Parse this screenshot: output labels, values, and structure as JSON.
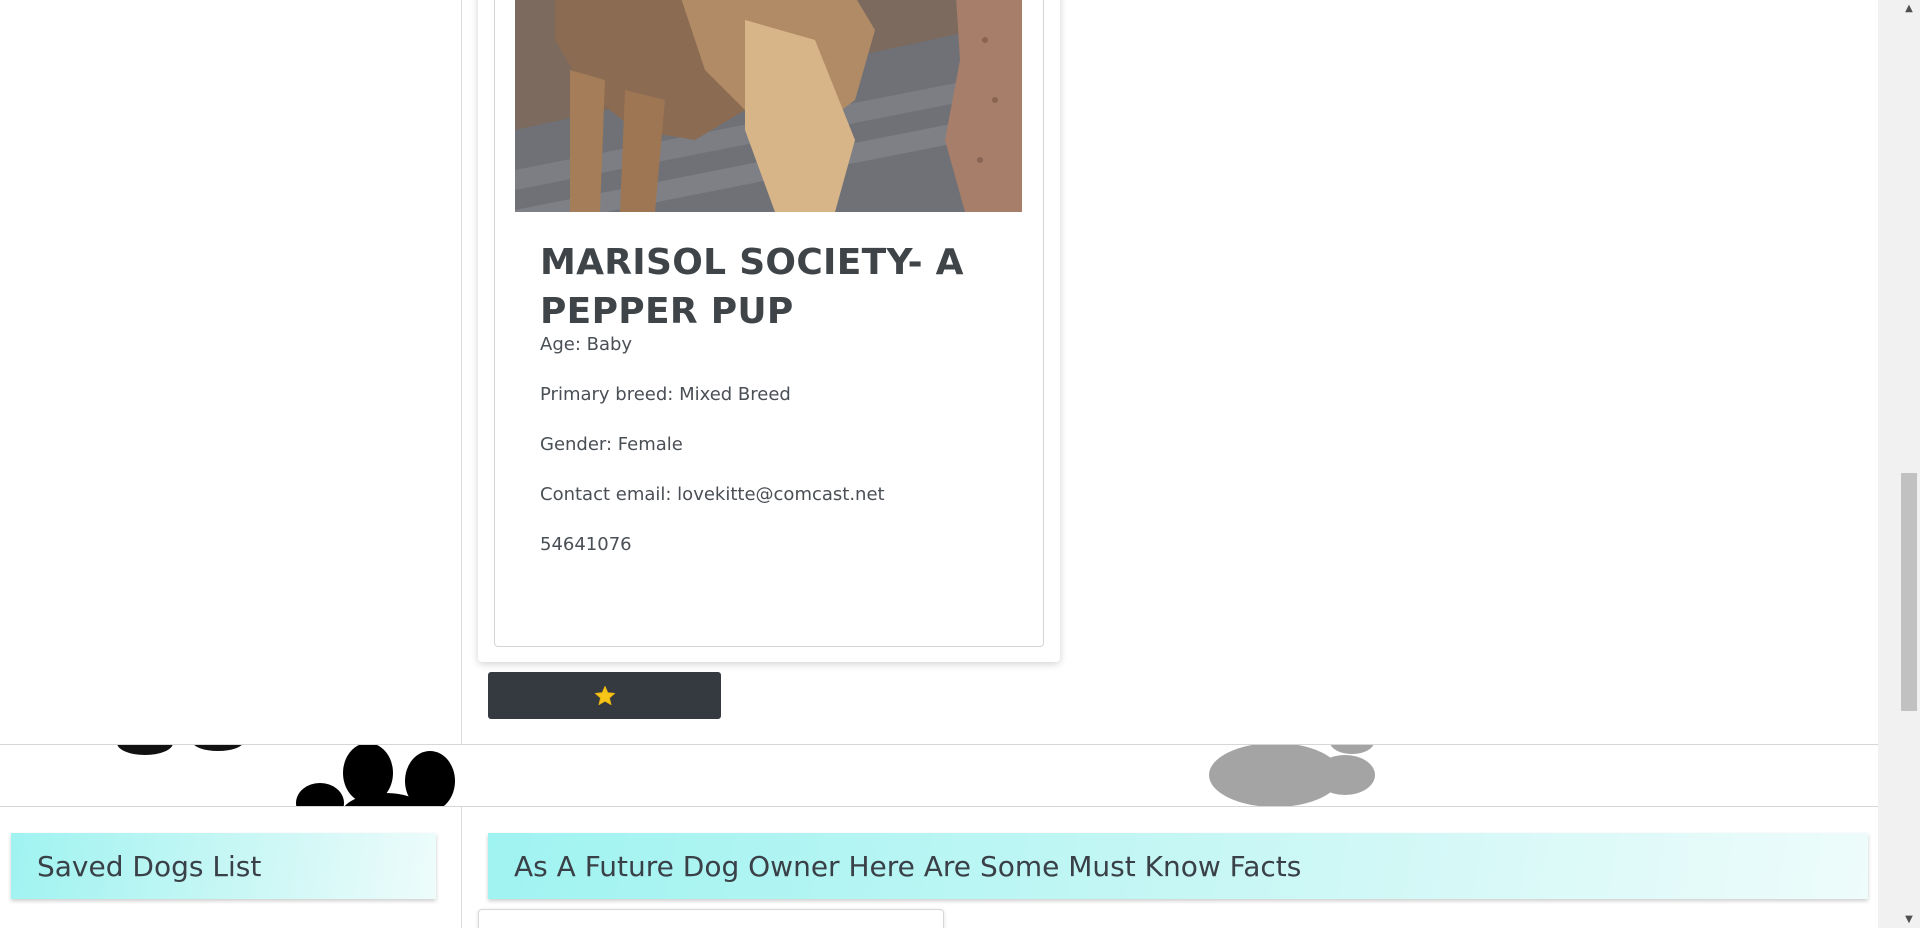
{
  "dog_card": {
    "title": "MARISOL SOCIETY- A PEPPER PUP",
    "age": "Age: Baby",
    "breed": "Primary breed: Mixed Breed",
    "gender": "Gender: Female",
    "email": "Contact email: lovekitte@comcast.net",
    "id": "54641076",
    "photo_icon": "dog-photo"
  },
  "favorite_button": {
    "icon": "star-icon",
    "icon_color": "#f5c518",
    "background": "#343a40"
  },
  "saved_list": {
    "heading": "Saved Dogs List"
  },
  "facts": {
    "heading": "As A Future Dog Owner Here Are Some Must Know Facts"
  },
  "colors": {
    "heading_gradient_start": "#9ff3f1",
    "heading_gradient_end": "#eefcfb",
    "button_dark": "#343a40"
  }
}
